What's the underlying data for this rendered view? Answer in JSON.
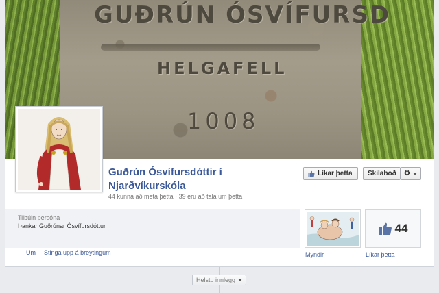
{
  "cover": {
    "engraving_line1": "GUÐRÚN ÓSVÍFURSD",
    "engraving_line2": "HELGAFELL",
    "engraving_line3": "1008"
  },
  "page": {
    "title": "Guðrún Ósvífursdóttir í Njarðvíkurskóla",
    "stats": "44 kunna að meta þetta · 39 eru að tala um þetta"
  },
  "actions": {
    "like_label": "Líkar þetta",
    "message_label": "Skilaboð"
  },
  "about": {
    "category": "Tilbúin persóna",
    "description": "Þankar Guðrúnar Ósvífursdóttur"
  },
  "links": {
    "about": "Um",
    "separator": "·",
    "suggest_edits": "Stinga upp á breytingum"
  },
  "tiles": {
    "photos_label": "Myndir",
    "likes_count": "44",
    "likes_label": "Líkar þetta"
  },
  "timeline": {
    "filter_label": "Helstu innlegg"
  },
  "colors": {
    "link_blue": "#3b5998",
    "background": "#e9ebee"
  }
}
